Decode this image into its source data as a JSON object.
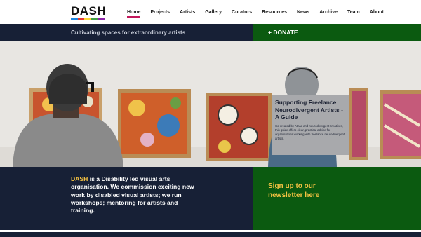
{
  "brand": {
    "logo_text": "DASH",
    "bar_colors": [
      "#1e88e5",
      "#e53935",
      "#fdd835",
      "#43a047",
      "#8e24aa"
    ]
  },
  "nav": {
    "items": [
      {
        "label": "Home",
        "active": true
      },
      {
        "label": "Projects"
      },
      {
        "label": "Artists"
      },
      {
        "label": "Gallery"
      },
      {
        "label": "Curators"
      },
      {
        "label": "Resources"
      },
      {
        "label": "News"
      },
      {
        "label": "Archive"
      },
      {
        "label": "Team"
      },
      {
        "label": "About"
      }
    ]
  },
  "tagline": "Cultivating spaces for extraordinary artists",
  "donate_label": "+ DONATE",
  "hero": {
    "card_title": "Supporting Freelance Neurodivergent Artists - A Guide",
    "card_text": "Co-created by Athac and neurodivergent creatives, this guide offers clear, practical advice for organisations working with freelance neurodivergent artists."
  },
  "about": {
    "highlight": "DASH",
    "text": " is a Disability led visual arts organisation. We commission exciting new work by disabled visual artists; we run workshops; mentoring for artists and training."
  },
  "newsletter_label": "Sign up to our newsletter here",
  "colors": {
    "navy": "#172036",
    "green": "#0b5a10",
    "yellow": "#f5c242",
    "accent": "#c2185b"
  }
}
